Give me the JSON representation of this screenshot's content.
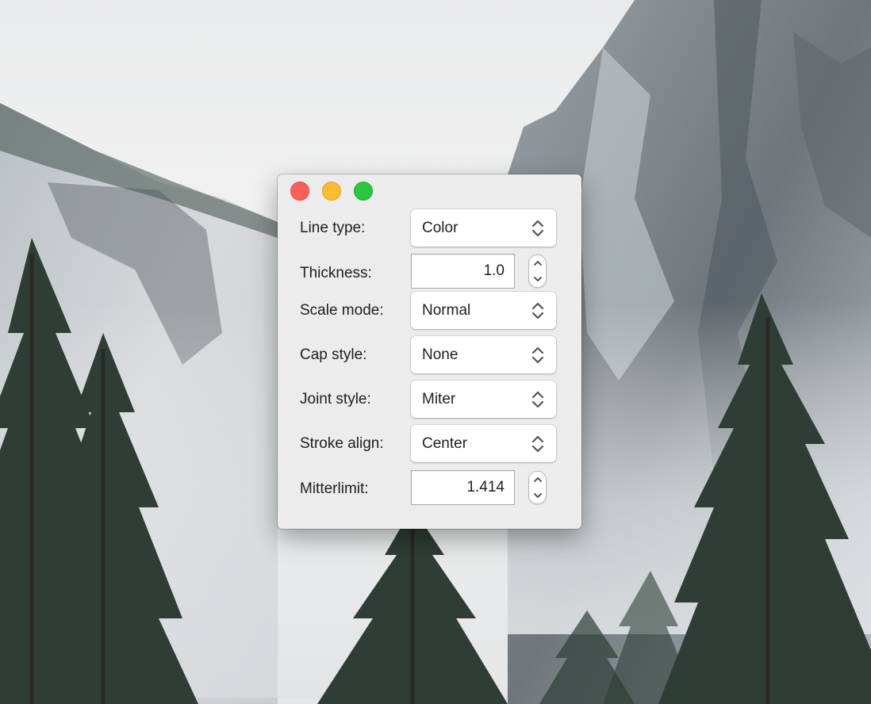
{
  "window": {
    "controls": {
      "close_color": "#fc5f57",
      "minimize_color": "#fdbc2e",
      "zoom_color": "#28c840"
    }
  },
  "form": {
    "line_type": {
      "label": "Line type:",
      "value": "Color"
    },
    "thickness": {
      "label": "Thickness:",
      "value": "1.0"
    },
    "scale_mode": {
      "label": "Scale mode:",
      "value": "Normal"
    },
    "cap_style": {
      "label": "Cap style:",
      "value": "None"
    },
    "joint_style": {
      "label": "Joint style:",
      "value": "Miter"
    },
    "stroke_align": {
      "label": "Stroke align:",
      "value": "Center"
    },
    "mitterlimit": {
      "label": "Mitterlimit:",
      "value": "1.414"
    }
  },
  "icons": {
    "popup_arrows": "up-down-chevron-icon",
    "stepper_up": "chevron-up-icon",
    "stepper_down": "chevron-down-icon"
  }
}
